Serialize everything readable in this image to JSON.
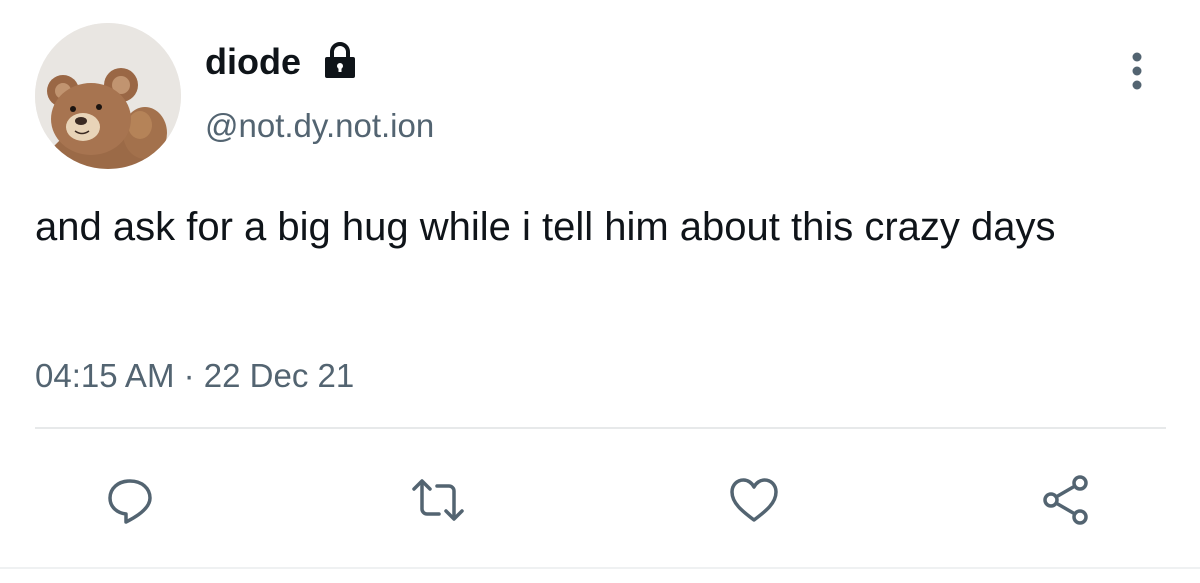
{
  "user": {
    "display_name": "diode",
    "handle": "@not.dy.not.ion",
    "avatar_icon": "teddy-bear-avatar",
    "protected_icon": "lock-icon"
  },
  "tweet": {
    "text": "and ask for a big hug while i tell him about this crazy days",
    "timestamp": "04:15 AM · 22 Dec 21"
  },
  "actions": [
    {
      "name": "reply",
      "icon": "reply-icon"
    },
    {
      "name": "retweet",
      "icon": "retweet-icon"
    },
    {
      "name": "like",
      "icon": "heart-icon"
    },
    {
      "name": "share",
      "icon": "share-icon"
    }
  ],
  "menu": {
    "icon": "more-vertical-icon"
  },
  "colors": {
    "text": "#0f1419",
    "secondary": "#536471",
    "divider": "#e7e9ea",
    "icon": "#536471"
  }
}
